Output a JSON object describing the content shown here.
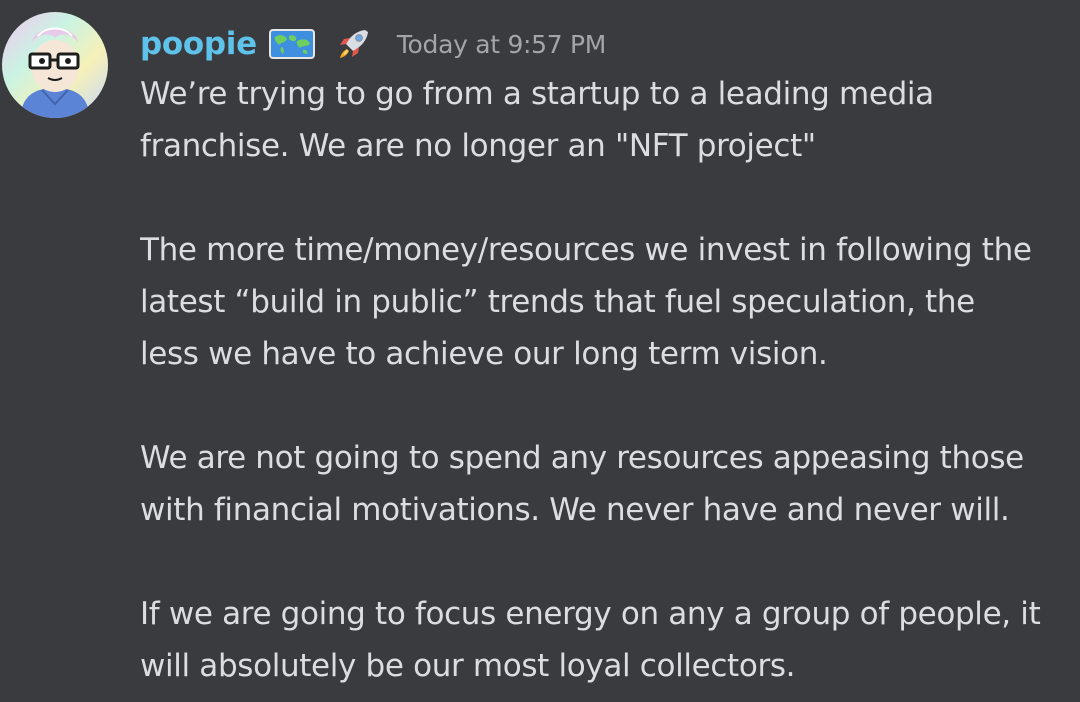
{
  "message": {
    "username": "poopie",
    "timestamp": "Today at 9:57 PM",
    "badge_icon": "world-map-badge-icon",
    "role_icon": "rocket-icon",
    "colors": {
      "background": "#3a3b3f",
      "username": "#5ec2ea",
      "text": "#dcdde0",
      "timestamp": "#a3a5ab"
    },
    "paragraphs": [
      {
        "lines": [
          "We’re trying to go from a startup to a leading media",
          "franchise. We are no longer an \"NFT project\""
        ]
      },
      {
        "lines": [
          "The more time/money/resources we invest in following the",
          "latest “build in public” trends that fuel speculation, the",
          "less we have to achieve our long term vision."
        ]
      },
      {
        "lines": [
          "We are not going to spend any resources appeasing those",
          "with financial motivations. We never have and never will."
        ]
      },
      {
        "lines": [
          "If we are going to focus energy on any a group of people, it",
          "will absolutely be our most loyal collectors."
        ]
      }
    ]
  }
}
